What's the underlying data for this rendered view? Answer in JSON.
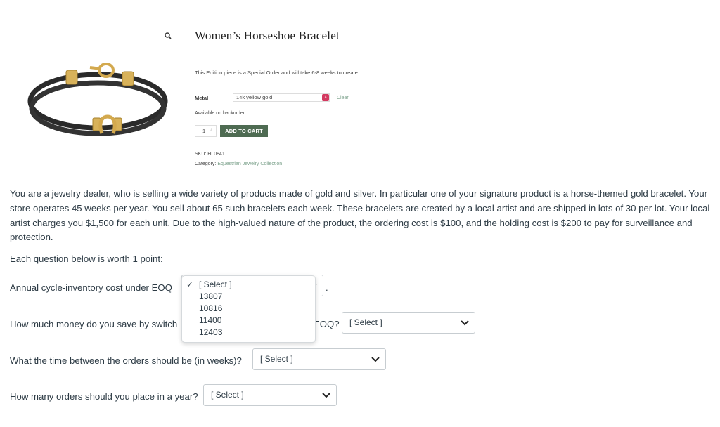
{
  "product": {
    "title": "Women’s Horseshoe Bracelet",
    "edition_text": "This Edition piece is a Special Order and will take 6-8 weeks to create.",
    "metal_label": "Metal",
    "metal_value": "14k yellow gold",
    "clear_label": "Clear",
    "availability": "Available on backorder",
    "quantity": "1",
    "add_to_cart": "ADD TO CART",
    "sku": "SKU: HL0841",
    "category_label": "Category:",
    "category_link": "Equestrian Jewelry Collection",
    "accent_color": "#4e6b52"
  },
  "problem": {
    "text": "You are a jewelry dealer, who is selling a wide variety of products made of gold and silver. In particular  one of your signature product is a horse-themed gold bracelet. Your store operates  45  weeks per year. You sell about 65 such bracelets each week. These bracelets are created by a local artist and are shipped in lots of 30 per lot. Your local artist charges you $1,500 for each unit. Due to the high-valued nature of the product, the ordering cost is $100, and the holding cost is $200 to pay for surveillance and protection.",
    "points_note": "Each question below is worth 1 point:"
  },
  "questions": {
    "q1": "Annual cycle-inventory cost under EOQ",
    "q1_suffix": ".",
    "q2_start": "How much money do you save by switch",
    "q2_end": "EOQ?",
    "q3": "What the time between the orders should be (in weeks)?",
    "q4": "How many orders should you place in a year?"
  },
  "selects": {
    "placeholder": "[ Select ]",
    "q1_options": [
      "[ Select ]",
      "13807",
      "10816",
      "11400",
      "12403"
    ],
    "q1_selected_mark": "✓"
  }
}
